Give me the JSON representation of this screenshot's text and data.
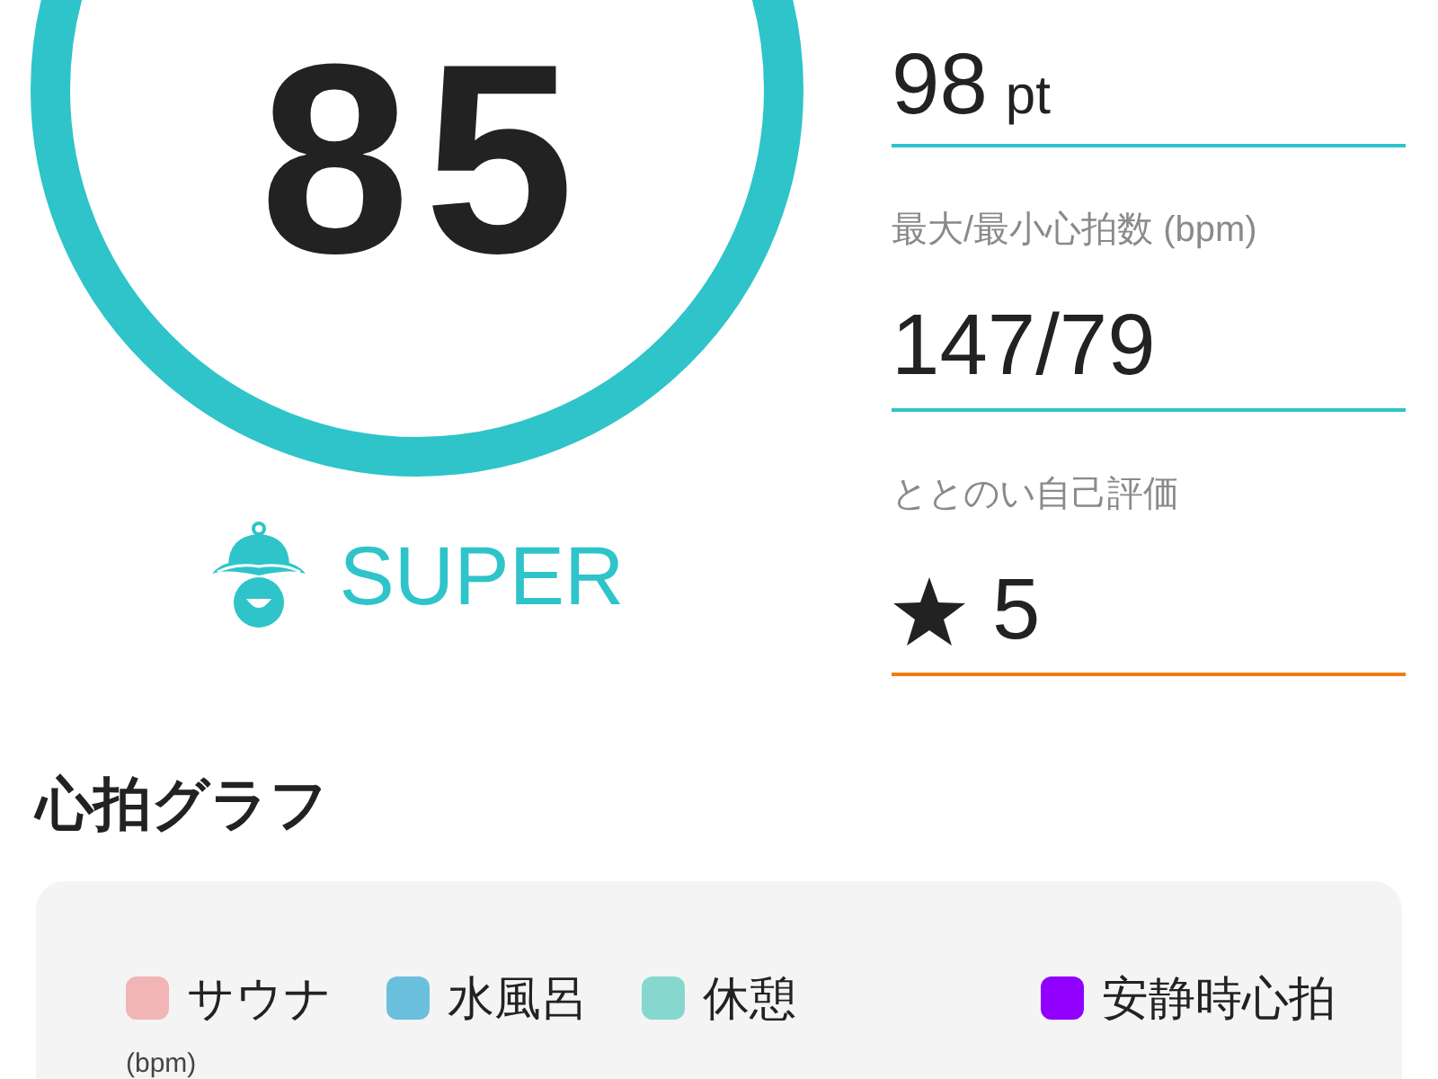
{
  "score": {
    "value": "85"
  },
  "rank": {
    "label": "SUPER"
  },
  "metrics": [
    {
      "kind": "points",
      "value": "98",
      "unit": "pt",
      "color": "#2ec4c9"
    },
    {
      "kind": "range",
      "label": "最大/最小心拍数 (bpm)",
      "value": "147/79",
      "color": "#2ec4c9"
    },
    {
      "kind": "rating",
      "label": "ととのい自己評価",
      "value": "5",
      "color": "#f17d0e"
    }
  ],
  "heart_rate_graph": {
    "title": "心拍グラフ",
    "legend": [
      {
        "label": "サウナ",
        "color": "#f1b5b5"
      },
      {
        "label": "水風呂",
        "color": "#6ac0dc"
      },
      {
        "label": "休憩",
        "color": "#86d8cf"
      },
      {
        "label": "安静時心拍",
        "color": "#9100ff"
      }
    ],
    "y_axis_label": "(bpm)"
  }
}
